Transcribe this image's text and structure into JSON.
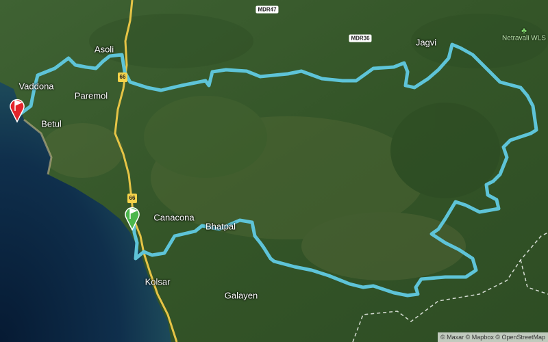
{
  "map": {
    "places": [
      {
        "name": "Asoli"
      },
      {
        "name": "Vaddona"
      },
      {
        "name": "Paremol"
      },
      {
        "name": "Betul"
      },
      {
        "name": "Canacona"
      },
      {
        "name": "Bhatpal"
      },
      {
        "name": "Kolsar"
      },
      {
        "name": "Galayen"
      },
      {
        "name": "Jagvi"
      }
    ],
    "park": {
      "name": "Netravali WLS"
    },
    "roads": {
      "mdr47": "MDR47",
      "mdr36": "MDR36",
      "nh_a": "66",
      "nh_b": "66"
    },
    "route_color": "#5ec4d8",
    "start_marker_color": "#4cb64c",
    "end_marker_color": "#e3242b",
    "attribution": "© Maxar © Mapbox © OpenStreetMap"
  }
}
